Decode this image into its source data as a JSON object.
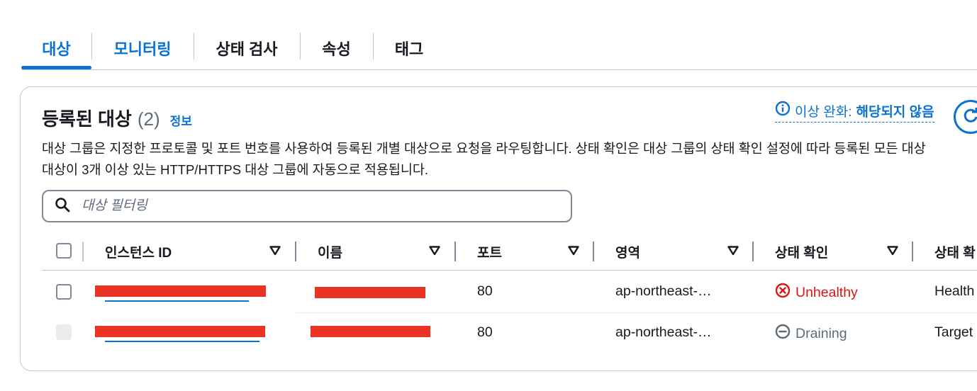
{
  "tabs": [
    {
      "label": "대상",
      "active": true
    },
    {
      "label": "모니터링"
    },
    {
      "label": "상태 검사"
    },
    {
      "label": "속성"
    },
    {
      "label": "태그"
    }
  ],
  "panel": {
    "title": "등록된 대상",
    "count": "(2)",
    "info": "정보",
    "stickiness_label": "이상 완화:",
    "stickiness_value": "해당되지 않음",
    "description_line1": "대상 그룹은 지정한 프로토콜 및 포트 번호를 사용하여 등록된 개별 대상으로 요청을 라우팅합니다. 상태 확인은 대상 그룹의 상태 확인 설정에 따라 등록된 모든 대상",
    "description_line2": "대상이 3개 이상 있는 HTTP/HTTPS 대상 그룹에 자동으로 적용됩니다."
  },
  "search": {
    "placeholder": "대상 필터링"
  },
  "table": {
    "headers": [
      "인스턴스 ID",
      "이름",
      "포트",
      "영역",
      "상태 확인",
      "상태 확"
    ],
    "rows": [
      {
        "port": "80",
        "zone": "ap-northeast-…",
        "health": "Unhealthy",
        "health_icon": "error-circle-icon",
        "details": "Health"
      },
      {
        "port": "80",
        "zone": "ap-northeast-…",
        "health": "Draining",
        "health_icon": "minus-circle-icon",
        "details": "Target"
      }
    ]
  },
  "colors": {
    "accent": "#0972d3",
    "error": "#d91515",
    "muted": "#5f6b7a",
    "redaction": "#ea3323"
  }
}
